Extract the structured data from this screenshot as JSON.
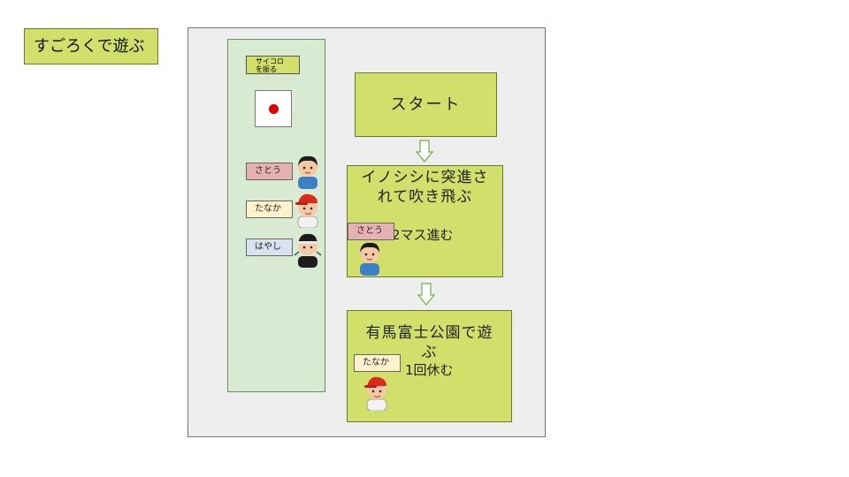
{
  "title": "すごろくで遊ぶ",
  "side_panel": {
    "roll_button_label": [
      "サイコロ",
      "を振る"
    ],
    "players": [
      {
        "name": "さとう"
      },
      {
        "name": "たなか"
      },
      {
        "name": "はやし"
      }
    ]
  },
  "board": {
    "start_label": "スタート",
    "squares": [
      {
        "title_lines": [
          "イノシシに突進さ",
          "れて吹き飛ぶ"
        ],
        "effect": "2マス進む",
        "player_tag": "さとう"
      },
      {
        "title_lines": [
          "有馬富士公園で遊",
          "ぶ"
        ],
        "effect": "1回休む",
        "player_tag": "たなか"
      }
    ]
  },
  "colors": {
    "cell_green": "#d1df6b",
    "board_gray": "#eeeeee",
    "panel_green": "#d8ead2",
    "dice_pip_red": "#e00000",
    "tag_sato": "#e6b1b3",
    "tag_tanaka": "#fff2cc",
    "tag_hayashi": "#d9e2ef"
  },
  "icons": [
    "dice-face-one-icon",
    "down-arrow-icon",
    "boy-avatar-icon",
    "baseball-cap-boy-icon",
    "masked-boy-icon"
  ]
}
